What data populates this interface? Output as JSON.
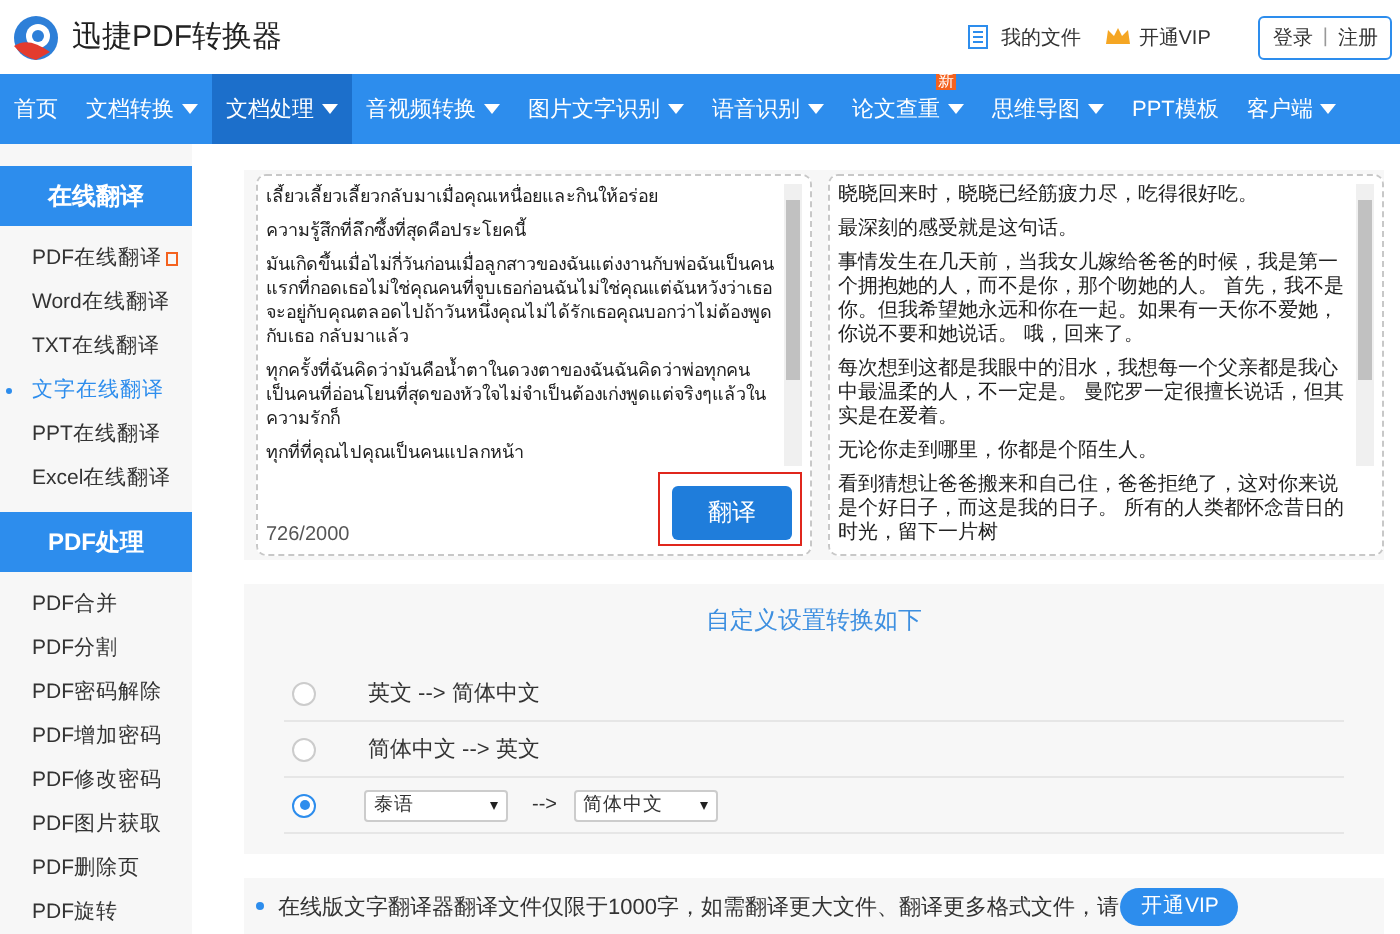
{
  "brand": {
    "name": "迅捷PDF转换器"
  },
  "header_links": [
    {
      "kind": "file",
      "label": "我的文件"
    },
    {
      "kind": "vip",
      "label": "开通VIP"
    }
  ],
  "auth": {
    "login": "登录",
    "separator": "|",
    "register": "注册"
  },
  "nav": [
    {
      "label": "首页",
      "selected": false,
      "dropdown": false
    },
    {
      "label": "文档转换",
      "selected": false,
      "dropdown": true
    },
    {
      "label": "文档处理",
      "selected": true,
      "dropdown": true
    },
    {
      "label": "音视频转换",
      "selected": false,
      "dropdown": true
    },
    {
      "label": "图片文字识别",
      "selected": false,
      "dropdown": true
    },
    {
      "label": "语音识别",
      "selected": false,
      "dropdown": true
    },
    {
      "label": "论文查重",
      "selected": false,
      "dropdown": true,
      "badge": "新"
    },
    {
      "label": "思维导图",
      "selected": false,
      "dropdown": true
    },
    {
      "label": "PPT模板",
      "selected": false,
      "dropdown": false
    },
    {
      "label": "客户端",
      "selected": false,
      "dropdown": true
    }
  ],
  "sidebar": [
    {
      "title": "在线翻译",
      "items": [
        {
          "label": "PDF在线翻译",
          "selected": false,
          "flag": true
        },
        {
          "label": "Word在线翻译",
          "selected": false,
          "flag": false
        },
        {
          "label": "TXT在线翻译",
          "selected": false,
          "flag": false
        },
        {
          "label": "文字在线翻译",
          "selected": true,
          "flag": false
        },
        {
          "label": "PPT在线翻译",
          "selected": false,
          "flag": false
        },
        {
          "label": "Excel在线翻译",
          "selected": false,
          "flag": false
        }
      ]
    },
    {
      "title": "PDF处理",
      "items": [
        {
          "label": "PDF合并",
          "selected": false,
          "flag": false
        },
        {
          "label": "PDF分割",
          "selected": false,
          "flag": false
        },
        {
          "label": "PDF密码解除",
          "selected": false,
          "flag": false
        },
        {
          "label": "PDF增加密码",
          "selected": false,
          "flag": false
        },
        {
          "label": "PDF修改密码",
          "selected": false,
          "flag": false
        },
        {
          "label": "PDF图片获取",
          "selected": false,
          "flag": false
        },
        {
          "label": "PDF删除页",
          "selected": false,
          "flag": false
        },
        {
          "label": "PDF旋转",
          "selected": false,
          "flag": false
        }
      ]
    }
  ],
  "source": {
    "paragraphs": [
      "เลี้ยวเลี้ยวเลี้ยวกลับมาเมื่อคุณเหนื่อยและกินให้อร่อย",
      "ความรู้สึกที่ลึกซึ้งที่สุดคือประโยคนี้",
      "มันเกิดขึ้นเมื่อไม่กี่วันก่อนเมื่อลูกสาวของฉันแต่งงานกับพ่อฉันเป็นคนแรกที่กอดเธอไม่ใช่คุณคนที่จูบเธอก่อนฉันไม่ใช่คุณแต่ฉันหวังว่าเธอจะอยู่กับคุณตลอดไปถ้าวันหนึ่งคุณไม่ได้รักเธอคุณบอกว่าไม่ต้องพูดกับเธอ กลับมาแล้ว",
      "ทุกครั้งที่ฉันคิดว่ามันคือน้ำตาในดวงตาของฉันฉันคิดว่าพ่อทุกคนเป็นคนที่อ่อนโยนที่สุดของหัวใจไม่จำเป็นต้องเก่งพูดแต่จริงๆแล้วในความรักก็",
      "ทุกที่ที่คุณไปคุณเป็นคนแปลกหน้า"
    ],
    "counter": "726/2000",
    "button": "翻译"
  },
  "result": {
    "paragraphs": [
      "晓晓回来时，晓晓已经筋疲力尽，吃得很好吃。",
      "最深刻的感受就是这句话。",
      "事情发生在几天前，当我女儿嫁给爸爸的时候，我是第一个拥抱她的人，而不是你，那个吻她的人。 首先，我不是你。但我希望她永远和你在一起。如果有一天你不爱她，你说不要和她说话。 哦，回来了。",
      "每次想到这都是我眼中的泪水，我想每一个父亲都是我心中最温柔的人，不一定是。 曼陀罗一定很擅长说话，但其实是在爱着。",
      "无论你走到哪里，你都是个陌生人。",
      "看到猜想让爸爸搬来和自己住，爸爸拒绝了，这对你来说是个好日子，而这是我的日子。 所有的人类都怀念昔日的时光，留下一片树"
    ]
  },
  "settings": {
    "title": "自定义设置转换如下",
    "options": [
      {
        "kind": "fixed",
        "selected": false,
        "text": "英文 --> 简体中文"
      },
      {
        "kind": "fixed",
        "selected": false,
        "text": "简体中文 --> 英文"
      },
      {
        "kind": "select",
        "selected": true,
        "from": "泰语",
        "arrow": "-->",
        "to": "简体中文"
      }
    ]
  },
  "notice": {
    "text": "在线版文字翻译器翻译文件仅限于1000字，如需翻译更大文件、翻译更多格式文件，请",
    "button": "开通VIP"
  }
}
